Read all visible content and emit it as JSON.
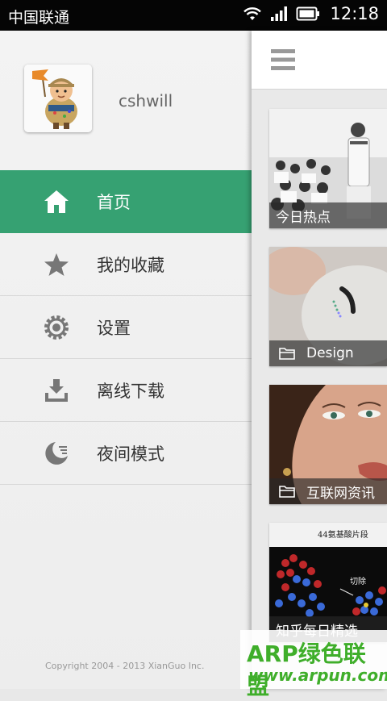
{
  "status_bar": {
    "carrier": "中国联通",
    "time": "12:18"
  },
  "drawer": {
    "username": "cshwill",
    "menu": [
      {
        "label": "首页",
        "icon": "home-icon",
        "active": true
      },
      {
        "label": "我的收藏",
        "icon": "star-icon",
        "active": false
      },
      {
        "label": "设置",
        "icon": "gear-icon",
        "active": false
      },
      {
        "label": "离线下载",
        "icon": "download-icon",
        "active": false
      },
      {
        "label": "夜间模式",
        "icon": "moon-icon",
        "active": false
      }
    ],
    "copyright": "Copyright 2004 - 2013 XianGuo Inc."
  },
  "main": {
    "cards": [
      {
        "title": "今日热点",
        "folder_icon": false
      },
      {
        "title": "Design",
        "folder_icon": true
      },
      {
        "title": "互联网资讯",
        "folder_icon": true
      },
      {
        "title": "知乎每日精选",
        "folder_icon": false
      }
    ],
    "card4_image_text": {
      "top": "44氨基酸片段",
      "mid": "切除"
    }
  },
  "watermark": {
    "line1": "ARP绿色联盟",
    "line2": "www.arpun.com"
  },
  "colors": {
    "accent": "#36a172",
    "status_bar": "#050505"
  }
}
